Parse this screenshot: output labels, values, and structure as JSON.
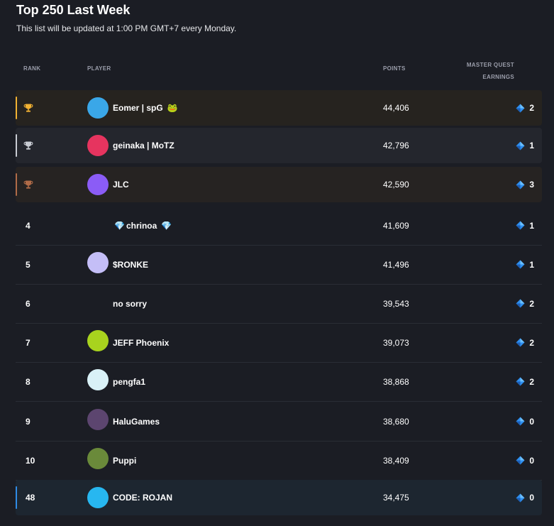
{
  "header": {
    "title": "Top 250 Last Week",
    "subtitle": "This list will be updated at 1:00 PM GMT+7 every Monday."
  },
  "columns": {
    "rank": "RANK",
    "player": "PLAYER",
    "points": "POINTS",
    "earnings_line1": "MASTER QUEST",
    "earnings_line2": "EARNINGS"
  },
  "colors": {
    "gold": "#f2b233",
    "silver": "#c9ccd3",
    "bronze": "#b06b48",
    "current_user": "#2f8be6",
    "diamond": "#2e8ff0"
  },
  "rows": [
    {
      "rank": "",
      "trophy": "gold-trophy-icon",
      "name": "Eomer | spG",
      "emoji_after": "🐸",
      "points": "44,406",
      "earnings": "2",
      "avatar_color": "#3aa7e8"
    },
    {
      "rank": "",
      "trophy": "silver-trophy-icon",
      "name": "geinaka | MoTZ",
      "points": "42,796",
      "earnings": "1",
      "avatar_color": "#e6345f"
    },
    {
      "rank": "",
      "trophy": "bronze-trophy-icon",
      "name": "JLC",
      "points": "42,590",
      "earnings": "3",
      "avatar_color": "#8b5cf6"
    },
    {
      "rank": "4",
      "name": "chrinoa",
      "emoji_before": "💎",
      "emoji_after": "💎",
      "points": "41,609",
      "earnings": "1",
      "avatar_color": ""
    },
    {
      "rank": "5",
      "name": "$RONKE",
      "points": "41,496",
      "earnings": "1",
      "avatar_color": "#c4bef7"
    },
    {
      "rank": "6",
      "name": "no sorry",
      "points": "39,543",
      "earnings": "2",
      "avatar_color": ""
    },
    {
      "rank": "7",
      "name": "JEFF Phoenix",
      "points": "39,073",
      "earnings": "2",
      "avatar_color": "#a8d31e"
    },
    {
      "rank": "8",
      "name": "pengfa1",
      "points": "38,868",
      "earnings": "2",
      "avatar_color": "#d9f1f7"
    },
    {
      "rank": "9",
      "name": "HaluGames",
      "points": "38,680",
      "earnings": "0",
      "avatar_color": "#5c456f"
    },
    {
      "rank": "10",
      "name": "Puppi",
      "points": "38,409",
      "earnings": "0",
      "avatar_color": "#6a8a3a"
    },
    {
      "rank": "48",
      "name": "CODE: ROJAN",
      "points": "34,475",
      "earnings": "0",
      "avatar_color": "#27b7f0"
    }
  ]
}
